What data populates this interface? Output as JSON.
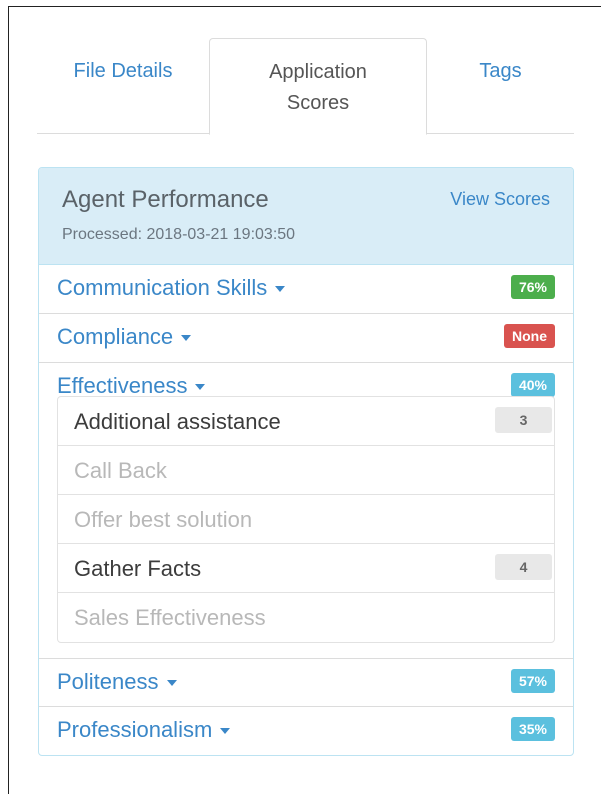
{
  "tabs": {
    "file_details": "File Details",
    "application_line1": "Application",
    "application_line2": "Scores",
    "tags": "Tags"
  },
  "panel": {
    "title": "Agent Performance",
    "processed": "Processed: 2018-03-21 19:03:50",
    "view_scores": "View Scores"
  },
  "categories": [
    {
      "label": "Communication Skills",
      "badge": "76%",
      "badge_color": "#4cae4c"
    },
    {
      "label": "Compliance",
      "badge": "None",
      "badge_color": "#d9534f"
    },
    {
      "label": "Effectiveness",
      "badge": "40%",
      "badge_color": "#5bc0de"
    },
    {
      "label": "Politeness",
      "badge": "57%",
      "badge_color": "#5bc0de"
    },
    {
      "label": "Professionalism",
      "badge": "35%",
      "badge_color": "#5bc0de"
    }
  ],
  "effectiveness_items": [
    {
      "label": "Additional assistance",
      "count": "3"
    },
    {
      "label": "Call Back",
      "count": ""
    },
    {
      "label": "Offer best solution",
      "count": ""
    },
    {
      "label": "Gather Facts",
      "count": "4"
    },
    {
      "label": "Sales Effectiveness",
      "count": ""
    }
  ]
}
